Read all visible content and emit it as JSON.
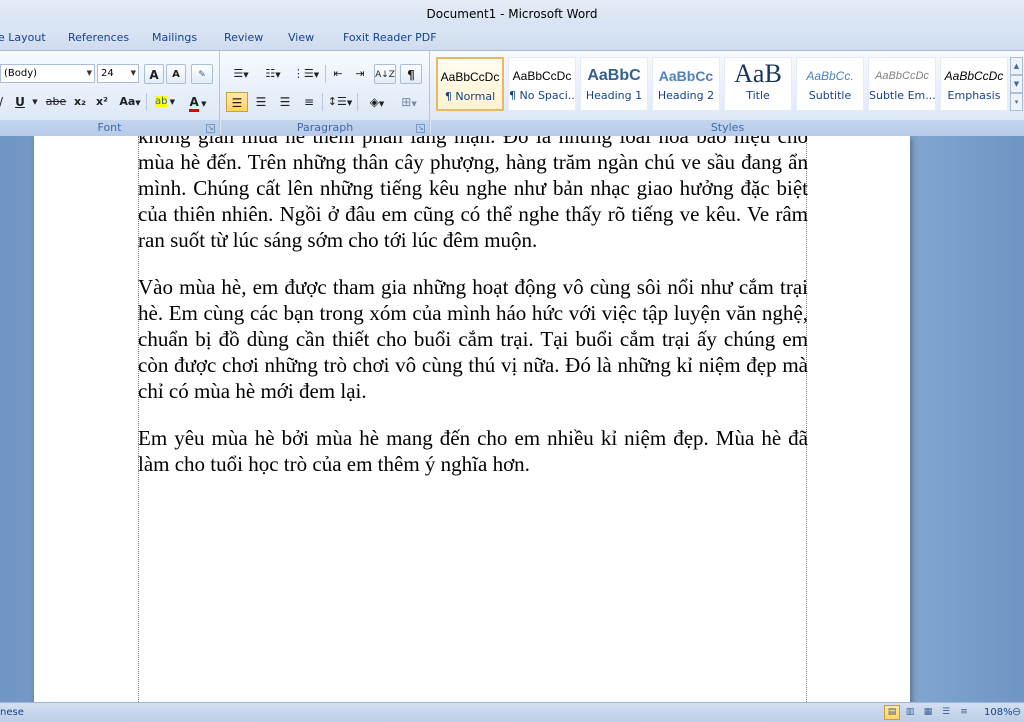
{
  "window": {
    "title": "Document1 - Microsoft Word"
  },
  "tabs": [
    "e Layout",
    "References",
    "Mailings",
    "Review",
    "View",
    "Foxit Reader PDF"
  ],
  "font_group": {
    "label": "Font",
    "font_name": "(Body)",
    "font_size": "24",
    "grow": "A",
    "shrink": "A",
    "underline": "U",
    "strike": "abe",
    "subscript": "x₂",
    "superscript": "x²",
    "change_case": "Aa",
    "highlight": "ab",
    "font_color": "A"
  },
  "paragraph_group": {
    "label": "Paragraph",
    "show_marks": "¶",
    "sort": "A↓Z"
  },
  "styles_group": {
    "label": "Styles",
    "tiles": [
      {
        "preview": "AaBbCcDc",
        "name": "¶ Normal"
      },
      {
        "preview": "AaBbCcDc",
        "name": "¶ No Spaci..."
      },
      {
        "preview": "AaBbC",
        "name": "Heading 1"
      },
      {
        "preview": "AaBbCc",
        "name": "Heading 2"
      },
      {
        "preview": "AaB",
        "name": "Title"
      },
      {
        "preview": "AaBbCc.",
        "name": "Subtitle"
      },
      {
        "preview": "AaBbCcDc",
        "name": "Subtle Em..."
      },
      {
        "preview": "AaBbCcDc",
        "name": "Emphasis"
      }
    ]
  },
  "document": {
    "paragraphs": [
      "không gian mùa hè thêm phần lãng mạn. Đó là những loài hoa báo hiệu cho mùa hè đến. Trên những thân cây phượng, hàng trăm ngàn chú ve sầu đang ẩn mình. Chúng cất lên những tiếng kêu nghe như bản nhạc giao hưởng đặc biệt của thiên nhiên. Ngồi ở đâu em cũng có thể nghe thấy rõ tiếng ve kêu. Ve râm ran suốt từ lúc sáng sớm cho tới lúc đêm muộn.",
      "Vào mùa hè, em được tham gia những hoạt động vô cùng sôi nổi như cắm trại hè. Em cùng các bạn trong xóm của mình háo hức với việc tập luyện văn nghệ, chuẩn bị đồ dùng cần thiết cho buổi cắm trại. Tại buổi cắm trại ấy chúng em còn được chơi những trò chơi vô cùng thú vị nữa. Đó là những kỉ niệm đẹp mà chỉ có mùa hè mới đem lại.",
      "Em yêu mùa hè bởi mùa hè mang đến cho em nhiều kỉ niệm đẹp. Mùa hè đã làm cho tuổi học trò của em thêm ý nghĩa hơn."
    ]
  },
  "statusbar": {
    "language": "nese",
    "zoom": "108%"
  },
  "colors": {
    "ribbon_text": "#15428b",
    "selected_style": "#e9b861",
    "workspace": "#8fb0d8"
  }
}
